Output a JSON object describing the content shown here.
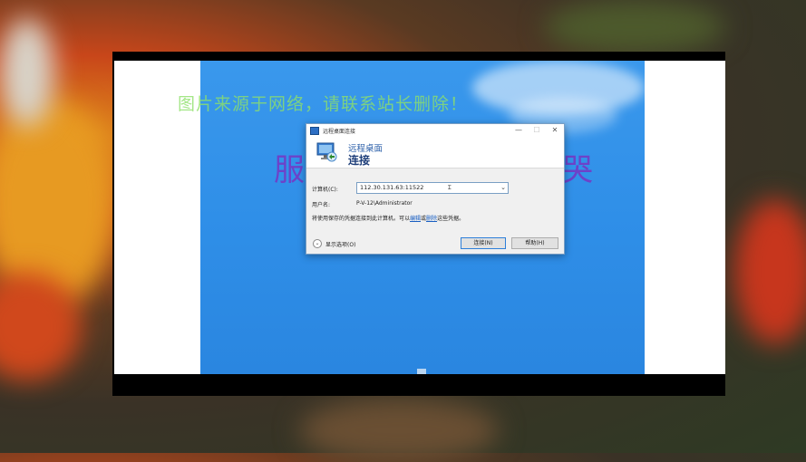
{
  "background": {
    "watermark": "图片来源于网络，请联系站长删除！",
    "title_left_char": "服",
    "title_right_char": "哭"
  },
  "dialog": {
    "window_title": "远程桌面连接",
    "window_buttons": {
      "minimize": "—",
      "maximize": "☐",
      "close": "✕"
    },
    "header_title": "远程桌面",
    "header_subtitle": "连接",
    "computer_label": "计算机(C):",
    "computer_value": "112.30.131.63:11522",
    "username_label": "用户名:",
    "username_value": "P-V-12\\Administrator",
    "saved_credentials_text": "将使用保存的凭据连接到此计算机。可以",
    "edit_link": "编辑",
    "or_text": "或",
    "delete_link": "删除",
    "credentials_suffix": "这些凭据。",
    "show_options": "显示选项(O)",
    "connect_button": "连接(N)",
    "help_button": "帮助(H)"
  },
  "colors": {
    "desktop_blue": "#2f8fe8",
    "header_title": "#2a5ea8",
    "link": "#1a5fc2",
    "watermark": "#8ee06a",
    "big_title": "#6d42c9"
  }
}
